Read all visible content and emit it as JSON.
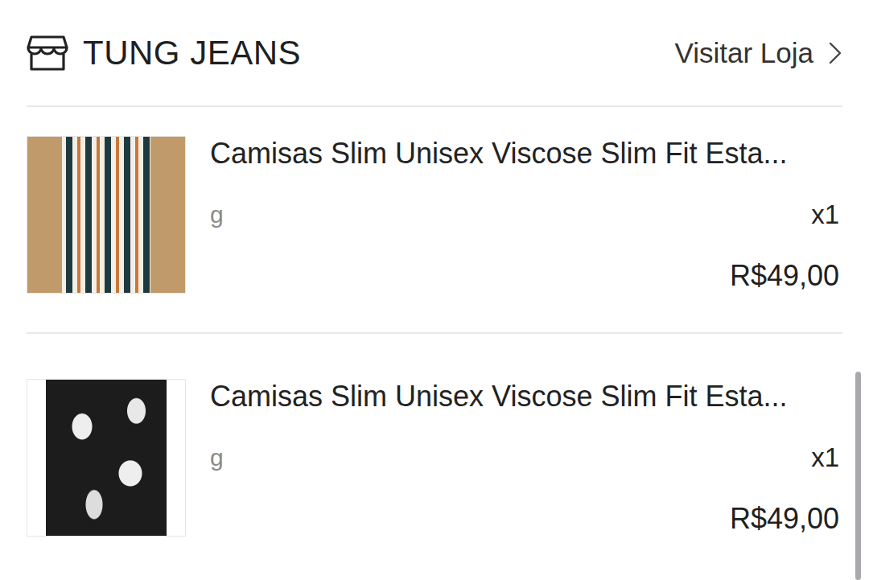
{
  "store": {
    "name": "TUNG JEANS",
    "visit_label": "Visitar Loja"
  },
  "items": [
    {
      "title": "Camisas Slim Unisex Viscose Slim Fit Esta...",
      "variant": "g",
      "quantity": "x1",
      "price": "R$49,00",
      "kind": "striped"
    },
    {
      "title": "Camisas Slim Unisex Viscose Slim Fit Esta...",
      "variant": "g",
      "quantity": "x1",
      "price": "R$49,00",
      "kind": "floral"
    }
  ],
  "scrollbar": {
    "level": 1
  }
}
